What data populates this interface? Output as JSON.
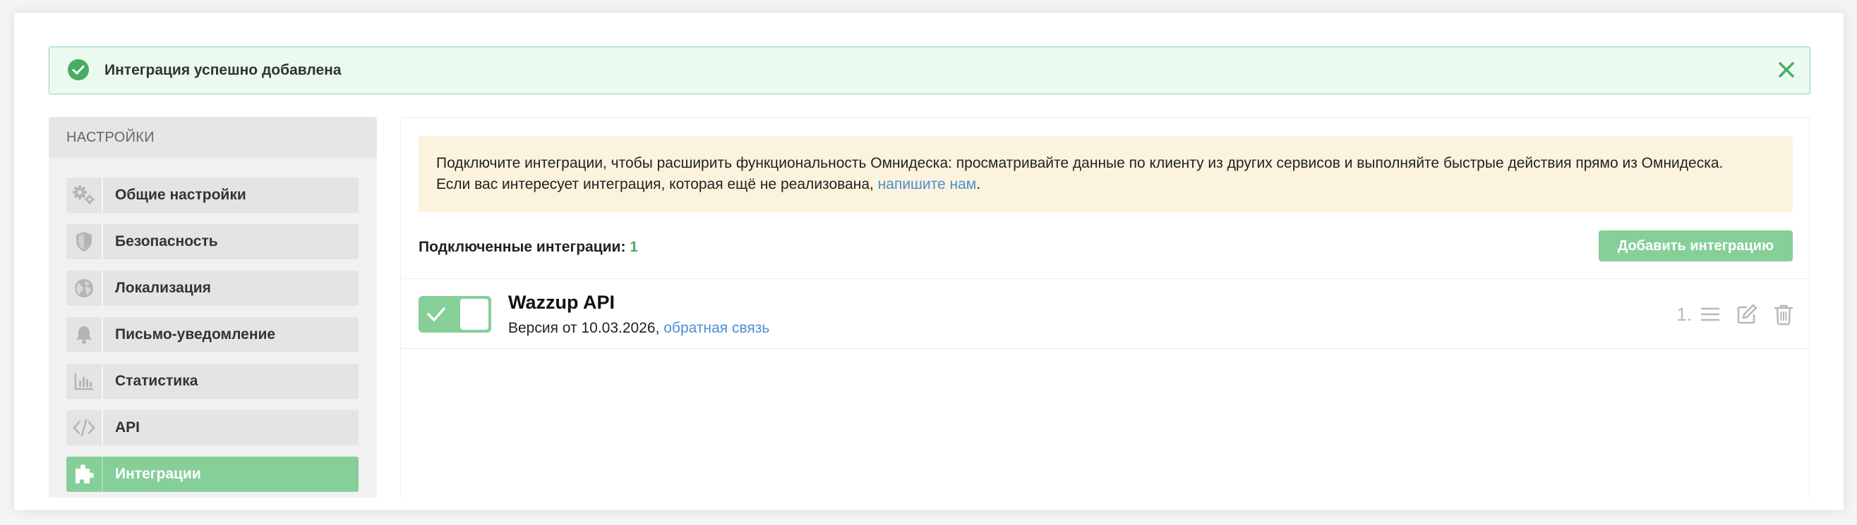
{
  "alert": {
    "text": "Интеграция успешно добавлена",
    "color": "#4aac63"
  },
  "sidebar": {
    "header": "НАСТРОЙКИ",
    "items": [
      {
        "label": "Общие настройки",
        "icon": "gears-icon"
      },
      {
        "label": "Безопасность",
        "icon": "shield-icon"
      },
      {
        "label": "Локализация",
        "icon": "globe-icon"
      },
      {
        "label": "Письмо-уведомление",
        "icon": "bell-icon"
      },
      {
        "label": "Статистика",
        "icon": "bar-chart-icon"
      },
      {
        "label": "API",
        "icon": "code-icon"
      },
      {
        "label": "Интеграции",
        "icon": "puzzle-icon",
        "active": true
      }
    ]
  },
  "main": {
    "info_line1": "Подключите интеграции, чтобы расширить функциональность Омнидеска: просматривайте данные по клиенту из других сервисов и выполняйте быстрые действия прямо из Омнидеска.",
    "info_line2": "Если вас интересует интеграция, которая ещё не реализована, ",
    "info_link": "напишите нам",
    "info_end": ".",
    "connected_label": "Подключенные интеграции: ",
    "connected_count": "1",
    "add_button": "Добавить интеграцию",
    "integration": {
      "name": "Wazzup API",
      "version_text": "Версия от 10.03.2026, ",
      "feedback_link": "обратная связь",
      "order": "1.",
      "enabled": true
    }
  },
  "colors": {
    "accent": "#86cf99",
    "link": "#4a8fcf",
    "info_bg": "#fbf3dd"
  }
}
